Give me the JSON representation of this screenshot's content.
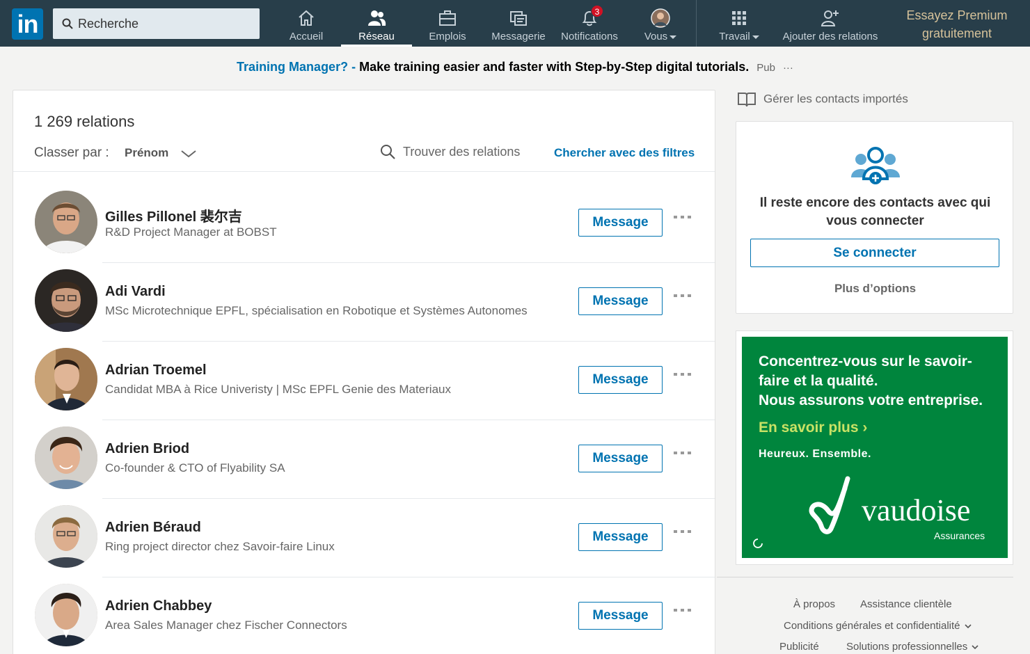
{
  "nav": {
    "logo": "in",
    "search_placeholder": "Recherche",
    "items": [
      {
        "label": "Accueil",
        "icon": "home-icon"
      },
      {
        "label": "Réseau",
        "icon": "network-icon"
      },
      {
        "label": "Emplois",
        "icon": "briefcase-icon"
      },
      {
        "label": "Messagerie",
        "icon": "messaging-icon"
      },
      {
        "label": "Notifications",
        "icon": "bell-icon",
        "badge": "3"
      },
      {
        "label": "Vous",
        "icon": "avatar"
      },
      {
        "label": "Travail",
        "icon": "grid-icon"
      },
      {
        "label": "Ajouter des relations",
        "icon": "add-person-icon"
      }
    ],
    "premium_line1": "Essayez Premium",
    "premium_line2": "gratuitement",
    "active": "Réseau"
  },
  "ad_bar": {
    "link": "Training Manager? -",
    "text": "Make training easier and faster with Step-by-Step digital tutorials.",
    "pub": "Pub",
    "more": "···"
  },
  "connections": {
    "count": "1 269 relations",
    "sort_label": "Classer par :",
    "sort_value": "Prénom",
    "find_placeholder": "Trouver des relations",
    "filters_link": "Chercher avec des filtres",
    "message_label": "Message",
    "rows": [
      {
        "name": "Gilles Pillonel 裴尔吉",
        "title": "R&D Project Manager at BOBST"
      },
      {
        "name": "Adi Vardi",
        "title": "MSc Microtechnique EPFL, spécialisation en Robotique et Systèmes Autonomes"
      },
      {
        "name": "Adrian Troemel",
        "title": "Candidat MBA à Rice Univeristy | MSc EPFL Genie des Materiaux"
      },
      {
        "name": "Adrien Briod",
        "title": "Co-founder & CTO of Flyability SA"
      },
      {
        "name": "Adrien Béraud",
        "title": "Ring project director chez Savoir-faire Linux"
      },
      {
        "name": "Adrien Chabbey",
        "title": "Area Sales Manager chez Fischer Connectors"
      }
    ]
  },
  "sidebar": {
    "manage": "Gérer les contacts importés",
    "connect_msg": "Il reste encore des contacts avec qui vous connecter",
    "connect_btn": "Se connecter",
    "more_options": "Plus d’options"
  },
  "vaudoise_ad": {
    "headline": "Concentrez-vous sur le savoir-faire et la qualité.",
    "headline2": "Nous assurons votre entreprise.",
    "cta": "En savoir plus ›",
    "slogan": "Heureux. Ensemble.",
    "brand": "vaudoise",
    "brand_sub": "Assurances",
    "bg_color": "#00853d"
  },
  "footer": {
    "about": "À propos",
    "help": "Assistance clientèle",
    "terms": "Conditions générales et confidentialité",
    "ads": "Publicité",
    "solutions": "Solutions professionnelles"
  },
  "colors": {
    "nav_bg": "#283e4a",
    "accent": "#0073b1",
    "premium": "#d6c29a"
  }
}
